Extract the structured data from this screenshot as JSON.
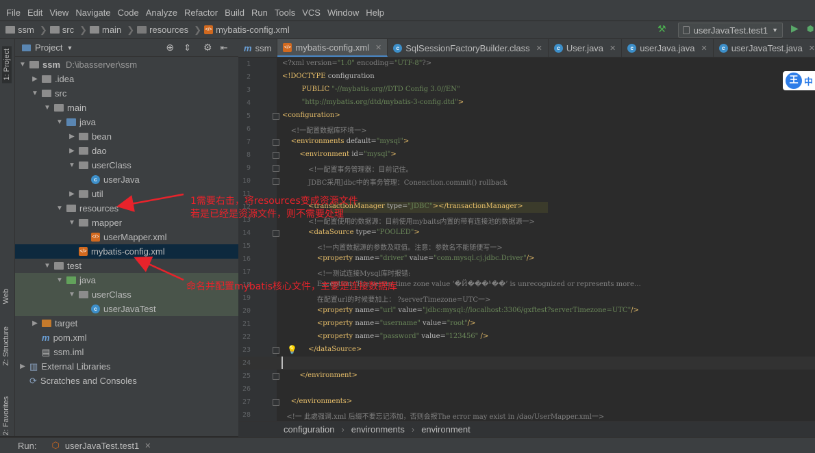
{
  "menu": [
    "File",
    "Edit",
    "View",
    "Navigate",
    "Code",
    "Analyze",
    "Refactor",
    "Build",
    "Run",
    "Tools",
    "VCS",
    "Window",
    "Help"
  ],
  "breadcrumbs": [
    "ssm",
    "src",
    "main",
    "resources",
    "mybatis-config.xml"
  ],
  "run_config": "userJavaTest.test1",
  "side_tabs": {
    "project": "1: Project",
    "web": "Web",
    "structure": "Z: Structure",
    "favorites": "2: Favorites"
  },
  "project_panel": {
    "title": "Project"
  },
  "tree": [
    {
      "label": "ssm",
      "extra": "D:\\ibasserver\\ssm",
      "icon": "folder-gray",
      "depth": 0,
      "arrow": "open"
    },
    {
      "label": ".idea",
      "icon": "folder-gray",
      "depth": 1,
      "arrow": "closed"
    },
    {
      "label": "src",
      "icon": "folder-gray",
      "depth": 1,
      "arrow": "open"
    },
    {
      "label": "main",
      "icon": "folder-gray",
      "depth": 2,
      "arrow": "open"
    },
    {
      "label": "java",
      "icon": "folder-blue",
      "depth": 3,
      "arrow": "open"
    },
    {
      "label": "bean",
      "icon": "folder-gray",
      "depth": 4,
      "arrow": "closed"
    },
    {
      "label": "dao",
      "icon": "folder-gray",
      "depth": 4,
      "arrow": "closed"
    },
    {
      "label": "userClass",
      "icon": "folder-gray",
      "depth": 4,
      "arrow": "open"
    },
    {
      "label": "userJava",
      "icon": "java-class",
      "depth": 5,
      "arrow": ""
    },
    {
      "label": "util",
      "icon": "folder-gray",
      "depth": 4,
      "arrow": "closed"
    },
    {
      "label": "resources",
      "icon": "folder-resources",
      "depth": 3,
      "arrow": "open"
    },
    {
      "label": "mapper",
      "icon": "folder-gray",
      "depth": 4,
      "arrow": "open"
    },
    {
      "label": "userMapper.xml",
      "icon": "xml-file",
      "depth": 5,
      "arrow": ""
    },
    {
      "label": "mybatis-config.xml",
      "icon": "xml-file",
      "depth": 4,
      "arrow": "",
      "selected": true
    },
    {
      "label": "test",
      "icon": "folder-gray",
      "depth": 2,
      "arrow": "open"
    },
    {
      "label": "java",
      "icon": "folder-green",
      "depth": 3,
      "arrow": "open",
      "test": true
    },
    {
      "label": "userClass",
      "icon": "folder-gray",
      "depth": 4,
      "arrow": "open",
      "test": true
    },
    {
      "label": "userJavaTest",
      "icon": "java-class",
      "depth": 5,
      "arrow": "",
      "test": true
    },
    {
      "label": "target",
      "icon": "folder-orange",
      "depth": 1,
      "arrow": "closed"
    },
    {
      "label": "pom.xml",
      "icon": "maven-file",
      "depth": 1,
      "arrow": ""
    },
    {
      "label": "ssm.iml",
      "icon": "iml-file",
      "depth": 1,
      "arrow": ""
    },
    {
      "label": "External Libraries",
      "icon": "libraries-icon",
      "depth": 0,
      "arrow": "closed"
    },
    {
      "label": "Scratches and Consoles",
      "icon": "scratches-icon",
      "depth": 0,
      "arrow": ""
    }
  ],
  "tabs": [
    {
      "label": "ssm",
      "icon": "module-icon",
      "closable": false
    },
    {
      "label": "mybatis-config.xml",
      "icon": "xml-file",
      "active": true
    },
    {
      "label": "SqlSessionFactoryBuilder.class",
      "icon": "class-file"
    },
    {
      "label": "User.java",
      "icon": "java-class"
    },
    {
      "label": "userJava.java",
      "icon": "java-class"
    },
    {
      "label": "userJavaTest.java",
      "icon": "java-class"
    }
  ],
  "code_lines": [
    {
      "n": "1",
      "html": "<span class='c'>&lt;?xml version=</span><span class='v'>\"1.0\"</span><span class='c'> encoding=</span><span class='v'>\"UTF-8\"</span><span class='c'>?&gt;</span>"
    },
    {
      "n": "2",
      "html": "<span class='t'>&lt;!DOCTYPE </span><span class='a'>configuration</span>"
    },
    {
      "n": "3",
      "html": "         <span class='t'>PUBLIC </span><span class='v'>\"-//mybatis.org//DTD Config 3.0//EN\"</span>"
    },
    {
      "n": "4",
      "html": "         <span class='v'>\"http://mybatis.org/dtd/mybatis-3-config.dtd\"</span><span class='t'>&gt;</span>"
    },
    {
      "n": "5",
      "html": "<span class='t'>&lt;configuration&gt;</span>"
    },
    {
      "n": "6",
      "html": "    <span class='c'>&lt;!一配置数据库环境一&gt;</span>"
    },
    {
      "n": "7",
      "html": "    <span class='t'>&lt;environments </span><span class='a'>default=</span><span class='v'>\"mysql\"</span><span class='t'>&gt;</span>"
    },
    {
      "n": "8",
      "html": "        <span class='t'>&lt;environment </span><span class='a'>id=</span><span class='v'>\"mysql\"</span><span class='t'>&gt;</span>"
    },
    {
      "n": "9",
      "html": "            <span class='c'>&lt;!一配置事务管理器：目前记住。</span>"
    },
    {
      "n": "10",
      "html": "            <span class='c'>JDBC采用Jdbc中的事务管理：Conenction.commit() rollback</span>"
    },
    {
      "n": "11",
      "html": ""
    },
    {
      "n": "12",
      "html": "            <span class='t'>&lt;transactionManager </span><span class='a'>type=</span><span class='v'>\"JDBC\"</span><span class='t'>&gt;&lt;/transactionManager&gt;</span>"
    },
    {
      "n": "13",
      "html": "            <span class='c'>&lt;!一配置使用的数据源：目前使用mybaits内置的带有连接池的数据源一&gt;</span>"
    },
    {
      "n": "14",
      "html": "            <span class='t'>&lt;dataSource </span><span class='a'>type=</span><span class='v'>\"POOLED\"</span><span class='t'>&gt;</span>"
    },
    {
      "n": "15",
      "html": "                <span class='c'>&lt;!一内置数据源的参数及取值。注意：参数名不能随便写一&gt;</span>"
    },
    {
      "n": "16",
      "html": "                <span class='t'>&lt;property </span><span class='a'>name=</span><span class='v'>\"driver\"</span><span class='a'> value=</span><span class='v'>\"com.mysql.cj.jdbc.Driver\"</span><span class='t'>/&gt;</span>"
    },
    {
      "n": "17",
      "html": "                <span class='c'>&lt;!一测试连接Mysql库时报错:</span>"
    },
    {
      "n": "18",
      "html": "                <span class='c'>Exception: The server time zone value ‘�Й���ʱ��’ is unrecognized or represents more…</span>"
    },
    {
      "n": "19",
      "html": "                <span class='c'>在配置url的时候要加上： ?serverTimezone=UTC一&gt;</span>"
    },
    {
      "n": "20",
      "html": "                <span class='t'>&lt;property </span><span class='a'>name=</span><span class='v'>\"url\"</span><span class='a'> value=</span><span class='v'>\"jdbc:mysql://localhost:3306/gxftest?serverTimezone=UTC\"</span><span class='t'>/&gt;</span>"
    },
    {
      "n": "21",
      "html": "                <span class='t'>&lt;property </span><span class='a'>name=</span><span class='v'>\"username\"</span><span class='a'> value=</span><span class='v'>\"root\"</span><span class='t'>/&gt;</span>"
    },
    {
      "n": "22",
      "html": "                <span class='t'>&lt;property </span><span class='a'>name=</span><span class='v'>\"password\"</span><span class='a'> value=</span><span class='v'>\"123456\"</span><span class='t'> /&gt;</span>"
    },
    {
      "n": "23",
      "html": "            <span class='t'>&lt;/dataSource&gt;</span>"
    },
    {
      "n": "24",
      "html": ""
    },
    {
      "n": "25",
      "html": "        <span class='t'>&lt;/environment&gt;</span>"
    },
    {
      "n": "26",
      "html": ""
    },
    {
      "n": "27",
      "html": "    <span class='t'>&lt;/environments&gt;</span>"
    },
    {
      "n": "28",
      "html": "  <span class='c'>&lt;!一 此處强调.xml 后缀不要忘记添加，否则会报The error may exist in /dao/UserMapper.xml一&gt;</span>"
    }
  ],
  "editor_breadcrumb": [
    "configuration",
    "environments",
    "environment"
  ],
  "run_bar": {
    "label": "Run:",
    "config": "userJavaTest.test1"
  },
  "annotations": {
    "note1_line1": "1需要右击，将resources变成资源文件",
    "note1_line2": "若是已经是资源文件，则不需要处理",
    "note2_line1": "命名并配置mybatis核心文件，主要是连接数据库"
  },
  "ime_badge": "中",
  "accent_colors": {
    "annotation": "#e8232b",
    "selection": "#0d293e",
    "test_bg": "#49544a"
  }
}
